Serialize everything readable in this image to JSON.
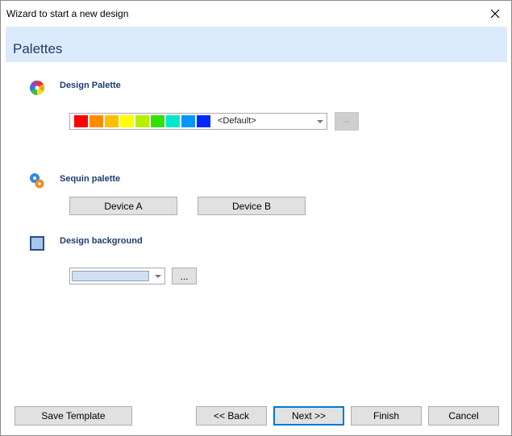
{
  "window": {
    "title": "Wizard to start a new design",
    "close_label": "close"
  },
  "header": {
    "title": "Palettes"
  },
  "design_palette": {
    "label": "Design Palette",
    "selected": "<Default>",
    "swatches": [
      "#ff0000",
      "#ff8c00",
      "#ffc000",
      "#ffff00",
      "#b4f000",
      "#33e000",
      "#00e8c8",
      "#0096ff",
      "#0028ff"
    ],
    "browse_label": "..."
  },
  "sequin_palette": {
    "label": "Sequin palette",
    "device_a_label": "Device A",
    "device_b_label": "Device B"
  },
  "design_background": {
    "label": "Design background",
    "color": "#cfe0f1",
    "browse_label": "..."
  },
  "footer": {
    "save_template_label": "Save Template",
    "back_label": "<< Back",
    "next_label": "Next >>",
    "finish_label": "Finish",
    "cancel_label": "Cancel"
  },
  "colors": {
    "header_band": "#dcebfb",
    "header_text": "#1f3b6d",
    "primary_border": "#0078d7"
  }
}
